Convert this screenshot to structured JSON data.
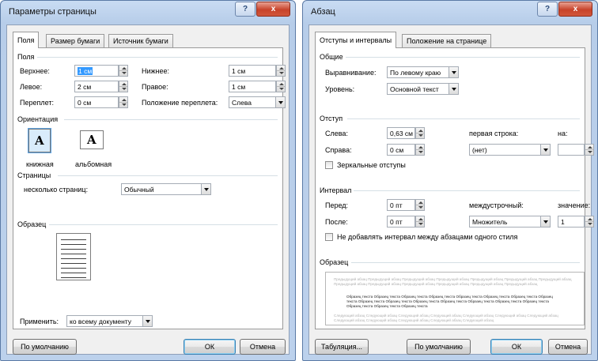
{
  "page_setup": {
    "title": "Параметры страницы",
    "help_label": "?",
    "close_label": "x",
    "tabs": [
      "Поля",
      "Размер бумаги",
      "Источник бумаги"
    ],
    "margins_section": "Поля",
    "top_label": "Верхнее:",
    "top_value": "1 см",
    "bottom_label": "Нижнее:",
    "bottom_value": "1 см",
    "left_label": "Левое:",
    "left_value": "2 см",
    "right_label": "Правое:",
    "right_value": "1 см",
    "gutter_label": "Переплет:",
    "gutter_value": "0 см",
    "gutter_pos_label": "Положение переплета:",
    "gutter_pos_value": "Слева",
    "orientation_section": "Ориентация",
    "portrait_label": "книжная",
    "landscape_label": "альбомная",
    "portrait_glyph": "A",
    "landscape_glyph": "A",
    "pages_section": "Страницы",
    "multiple_pages_label": "несколько страниц:",
    "multiple_pages_value": "Обычный",
    "preview_section": "Образец",
    "apply_label": "Применить:",
    "apply_value": "ко всему документу",
    "default_button": "По умолчанию",
    "ok_button": "ОК",
    "cancel_button": "Отмена"
  },
  "paragraph": {
    "title": "Абзац",
    "help_label": "?",
    "close_label": "x",
    "tabs": [
      "Отступы и интервалы",
      "Положение на странице"
    ],
    "general_section": "Общие",
    "alignment_label": "Выравнивание:",
    "alignment_value": "По левому краю",
    "level_label": "Уровень:",
    "level_value": "Основной текст",
    "indent_section": "Отступ",
    "left_label": "Слева:",
    "left_value": "0,63 см",
    "right_label": "Справа:",
    "right_value": "0 см",
    "first_line_label": "первая строка:",
    "first_line_value": "(нет)",
    "by_label": "на:",
    "by_value": "",
    "mirror_label": "Зеркальные отступы",
    "spacing_section": "Интервал",
    "before_label": "Перед:",
    "before_value": "0 пт",
    "after_label": "После:",
    "after_value": "0 пт",
    "line_spacing_label": "междустрочный:",
    "line_spacing_value": "Множитель",
    "at_label": "значение:",
    "at_value": "1",
    "no_space_label": "Не добавлять интервал между абзацами одного стиля",
    "preview_section": "Образец",
    "preview_prev": "Предыдущий абзац Предыдущий абзац Предыдущий абзац Предыдущий абзац Предыдущий абзац Предыдущий абзац Предыдущий абзац Предыдущий абзац Предыдущий абзац Предыдущий абзац Предыдущий абзац Предыдущий абзац Предыдущий абзац",
    "preview_sample": "Образец текста Образец текста Образец текста Образец текста Образец текста Образец текста Образец текста Образец текста Образец текста Образец текста Образец текста Образец текста Образец текста Образец текста Образец текста Образец текста Образец текста Образец текста",
    "preview_next": "Следующий абзац Следующий абзац Следующий абзац Следующий абзац Следующий абзац Следующий абзац Следующий абзац Следующий абзац Следующий абзац Следующий абзац Следующий абзац Следующий абзац",
    "tabs_button": "Табуляция...",
    "default_button": "По умолчанию",
    "ok_button": "ОК",
    "cancel_button": "Отмена"
  }
}
